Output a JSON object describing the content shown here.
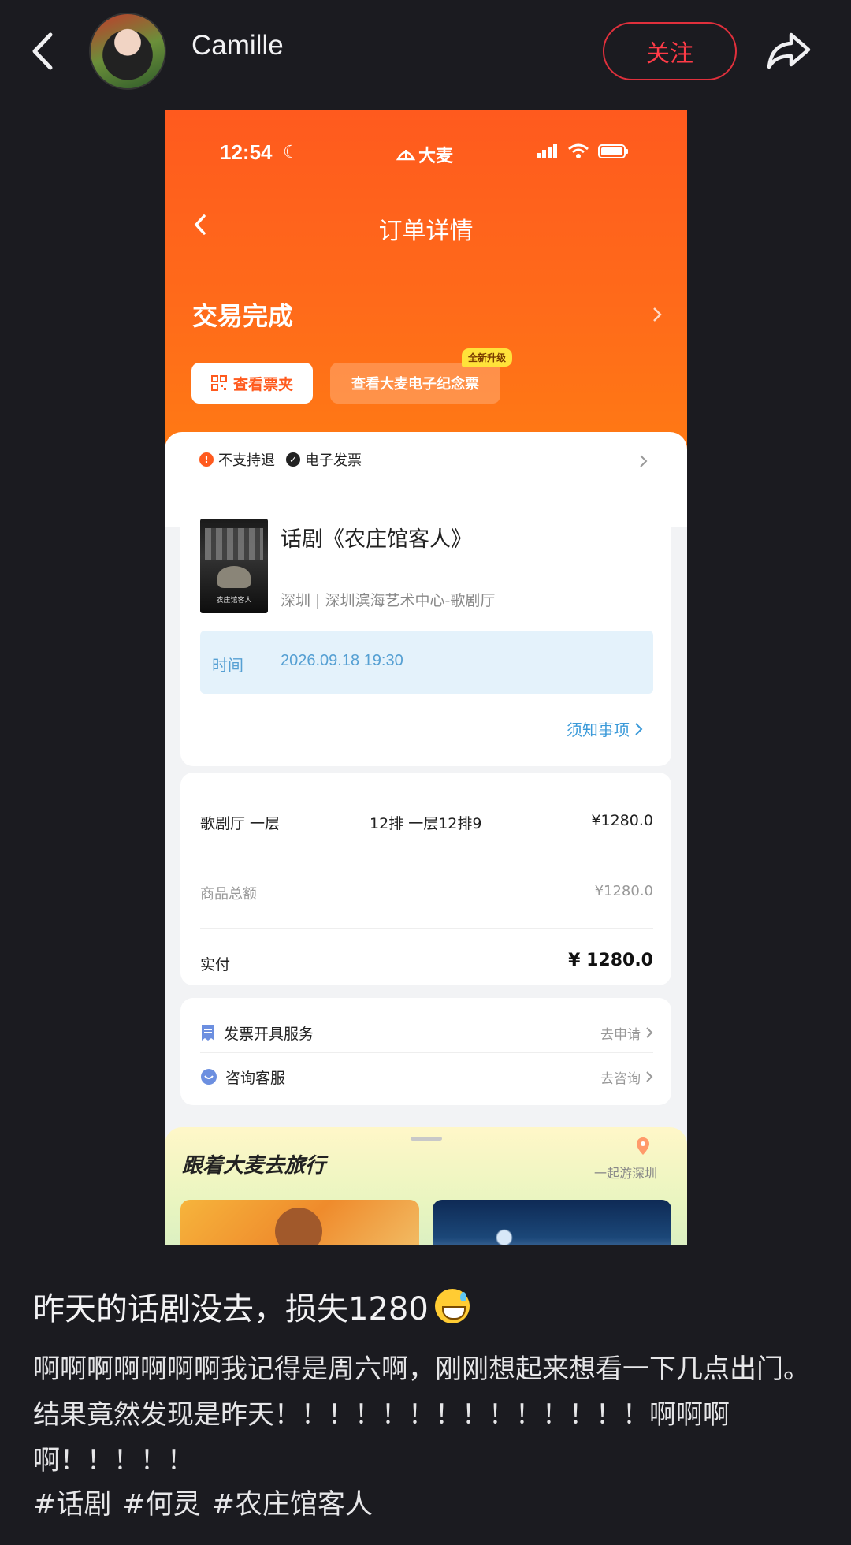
{
  "header": {
    "username": "Camille",
    "follow_label": "关注"
  },
  "screenshot": {
    "status_bar": {
      "time": "12:54",
      "brand": "大麦"
    },
    "nav_title": "订单详情",
    "order_status": "交易完成",
    "buttons": {
      "ticket_wallet": "查看票夹",
      "souvenir_ticket": "查看大麦电子纪念票",
      "upgrade_badge": "全新升级"
    },
    "tags": [
      "不支持退",
      "电子发票"
    ],
    "show": {
      "title": "话剧《农庄馆客人》",
      "poster_text": "农庄馆客人",
      "venue": "深圳 | 深圳滨海艺术中心-歌剧厅",
      "time_label": "时间",
      "time_value": "2026.09.18 19:30",
      "notice_link": "须知事项"
    },
    "price": {
      "seat_area": "歌剧厅 一层",
      "seat_position": "12排 一层12排9",
      "seat_price": "¥1280.0",
      "subtotal_label": "商品总额",
      "subtotal_value": "¥1280.0",
      "paid_label": "实付",
      "paid_value": "¥ 1280.0"
    },
    "services": [
      {
        "label": "发票开具服务",
        "action": "去申请"
      },
      {
        "label": "咨询客服",
        "action": "去咨询"
      }
    ],
    "travel": {
      "title": "跟着大麦去旅行",
      "subtitle": "一起游深圳"
    }
  },
  "post": {
    "title": "昨天的话剧没去，损失1280",
    "body": "啊啊啊啊啊啊啊我记得是周六啊，刚刚想起来想看一下几点出门。结果竟然发现是昨天！！！！！！！！！！！！！！啊啊啊啊！！！！！",
    "hashtags": [
      "#话剧",
      "#何灵",
      "#农庄馆客人"
    ]
  },
  "colors": {
    "accent": "#ff3b47",
    "order_orange": "#ff5a1e",
    "time_blue": "#56a0d3"
  },
  "icons": [
    "back-arrow-icon",
    "share-icon",
    "moon-icon",
    "signal-icon",
    "wifi-icon",
    "battery-icon",
    "qr-icon",
    "info-icon",
    "check-icon",
    "chevron-right-icon",
    "invoice-icon",
    "chat-icon",
    "location-pin-icon",
    "grinning-sweat-emoji"
  ]
}
